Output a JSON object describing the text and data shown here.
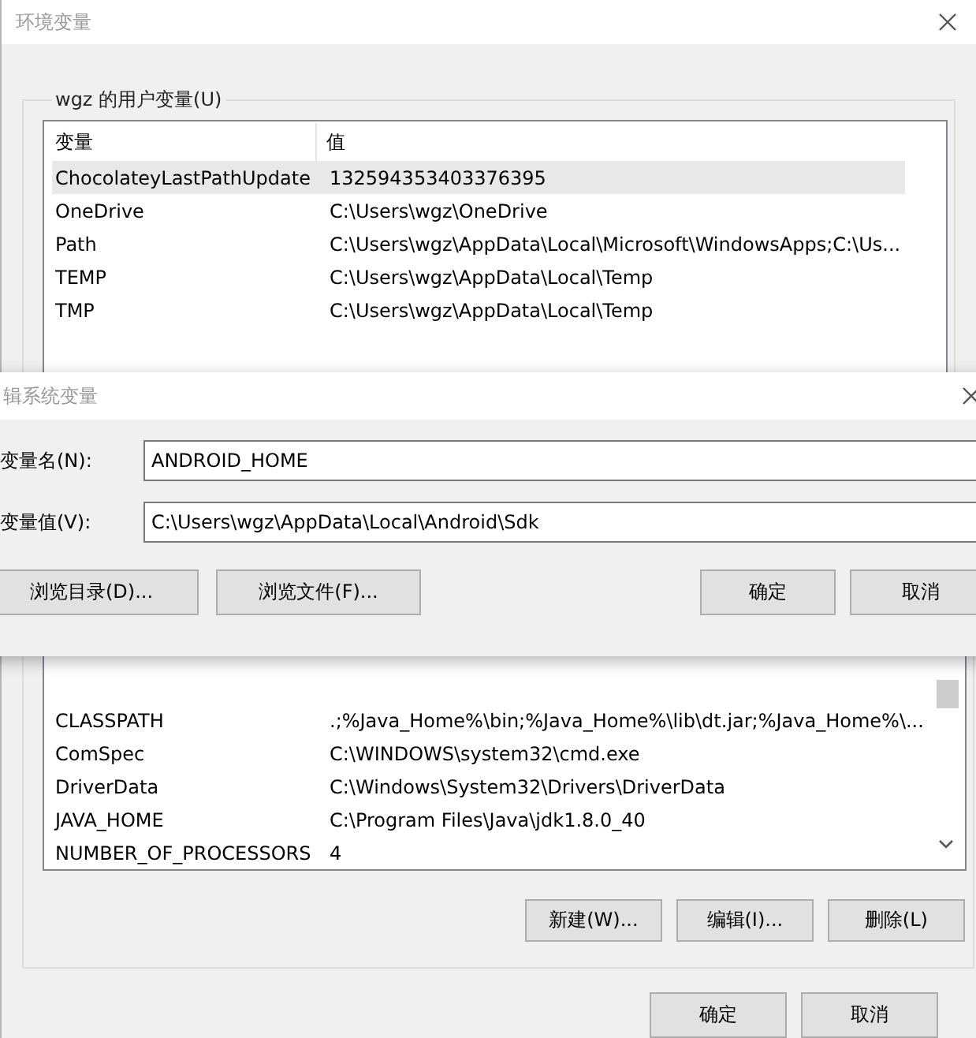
{
  "env_window": {
    "title": "环境变量",
    "user_vars": {
      "label": "wgz 的用户变量(U)",
      "columns": [
        "变量",
        "值"
      ],
      "rows": [
        {
          "name": "ChocolateyLastPathUpdate",
          "value": "132594353403376395",
          "selected": true
        },
        {
          "name": "OneDrive",
          "value": "C:\\Users\\wgz\\OneDrive",
          "selected": false
        },
        {
          "name": "Path",
          "value": "C:\\Users\\wgz\\AppData\\Local\\Microsoft\\WindowsApps;C:\\Us...",
          "selected": false
        },
        {
          "name": "TEMP",
          "value": "C:\\Users\\wgz\\AppData\\Local\\Temp",
          "selected": false
        },
        {
          "name": "TMP",
          "value": "C:\\Users\\wgz\\AppData\\Local\\Temp",
          "selected": false
        }
      ]
    },
    "system_vars": {
      "rows": [
        {
          "name": "CLASSPATH",
          "value": ".;%Java_Home%\\bin;%Java_Home%\\lib\\dt.jar;%Java_Home%\\..."
        },
        {
          "name": "ComSpec",
          "value": "C:\\WINDOWS\\system32\\cmd.exe"
        },
        {
          "name": "DriverData",
          "value": "C:\\Windows\\System32\\Drivers\\DriverData"
        },
        {
          "name": "JAVA_HOME",
          "value": "C:\\Program Files\\Java\\jdk1.8.0_40"
        },
        {
          "name": "NUMBER_OF_PROCESSORS",
          "value": "4"
        }
      ],
      "buttons": [
        "新建(W)...",
        "编辑(I)...",
        "删除(L)"
      ]
    },
    "buttons": [
      "确定",
      "取消"
    ]
  },
  "edit_dialog": {
    "title": "辑系统变量",
    "fields": [
      {
        "label": "变量名(N):",
        "value": "ANDROID_HOME"
      },
      {
        "label": "变量值(V):",
        "value": "C:\\Users\\wgz\\AppData\\Local\\Android\\Sdk"
      }
    ],
    "browse_buttons": [
      "浏览目录(D)...",
      "浏览文件(F)..."
    ],
    "buttons": [
      "确定",
      "取消"
    ]
  }
}
